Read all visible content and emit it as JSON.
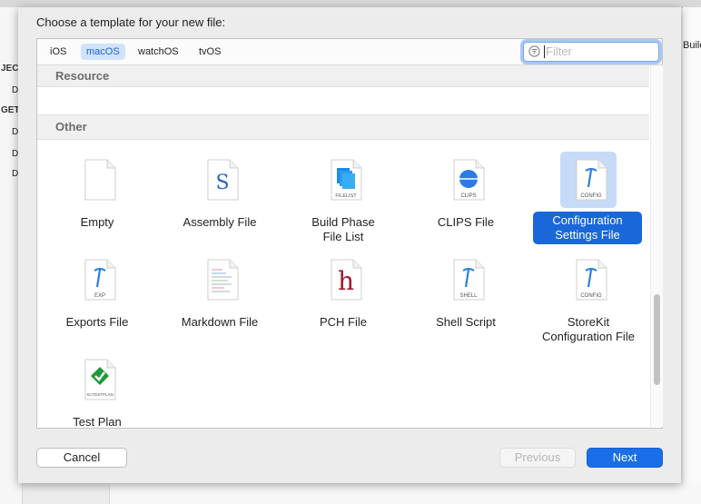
{
  "dialog": {
    "title": "Choose a template for your new file:"
  },
  "platform_tabs": [
    {
      "label": "iOS"
    },
    {
      "label": "macOS",
      "selected": true
    },
    {
      "label": "watchOS"
    },
    {
      "label": "tvOS"
    }
  ],
  "filter": {
    "placeholder": "Filter",
    "icon": "filter-icon"
  },
  "sections": {
    "resource": "Resource",
    "other": "Other"
  },
  "templates": [
    {
      "label_lines": [
        "Empty"
      ],
      "icon": "empty-file-icon"
    },
    {
      "label_lines": [
        "Assembly File"
      ],
      "icon": "assembly-file-icon",
      "glyph": "S"
    },
    {
      "label_lines": [
        "Build Phase",
        "File List"
      ],
      "icon": "filelist-icon",
      "badge": "FILELIST"
    },
    {
      "label_lines": [
        "CLIPS File"
      ],
      "icon": "clips-icon",
      "badge": "CLIPS"
    },
    {
      "label_lines": [
        "Configuration",
        "Settings File"
      ],
      "icon": "config-file-icon",
      "badge": "CONFIG",
      "selected": true
    },
    {
      "label_lines": [
        "Exports File"
      ],
      "icon": "exports-file-icon",
      "badge": "EXP"
    },
    {
      "label_lines": [
        "Markdown File"
      ],
      "icon": "markdown-file-icon"
    },
    {
      "label_lines": [
        "PCH File"
      ],
      "icon": "pch-file-icon",
      "glyph": "h"
    },
    {
      "label_lines": [
        "Shell Script"
      ],
      "icon": "shell-script-icon",
      "badge": "SHELL"
    },
    {
      "label_lines": [
        "StoreKit",
        "Configuration File"
      ],
      "icon": "storekit-config-icon",
      "badge": "CONFIG"
    },
    {
      "label_lines": [
        "Test Plan"
      ],
      "icon": "test-plan-icon",
      "badge": "XCTESTPLAN"
    }
  ],
  "buttons": {
    "cancel": "Cancel",
    "previous": "Previous",
    "next": "Next"
  },
  "background": {
    "left_texts": [
      "JEC",
      "D",
      "GET",
      "D",
      "D",
      "D"
    ],
    "right_text": "Build"
  },
  "colors": {
    "accent": "#1a6fe8",
    "selection": "#1a67d9",
    "tab_selected_bg": "#d0e3fb"
  }
}
